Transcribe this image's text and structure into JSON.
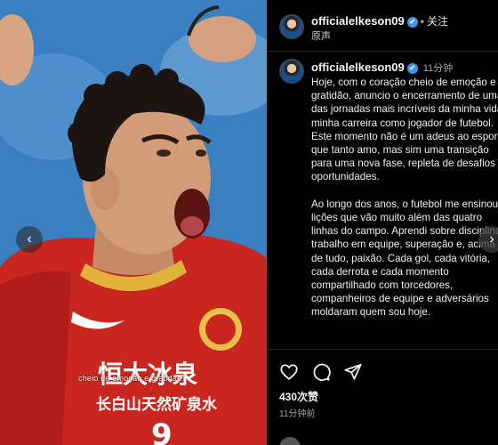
{
  "media": {
    "caption": "cheio de emoção e gratidão",
    "sponsor_line1": "恒大冰泉",
    "sponsor_line2": "长白山天然矿泉水",
    "jersey_number": "9",
    "prev_label": "‹",
    "next_label": "›"
  },
  "header": {
    "username": "officialelkeson09",
    "verified_mark": "✔",
    "separator": "•",
    "follow_label": "关注",
    "audio_label": "原声"
  },
  "post": {
    "username": "officialelkeson09",
    "verified_mark": "✔",
    "time": "11分钟",
    "text": "Hoje, com o coração cheio de emoção e gratidão, anuncio o encerramento de uma das jornadas mais incríveis da minha vida: minha carreira como jogador de futebol. Este momento não é um adeus ao esporte que tanto amo, mas sim uma transição para uma nova fase, repleta de desafios e oportunidades.\n\nAo longo dos anos, o futebol me ensinou lições que vão muito além das quatro linhas do campo. Aprendi sobre disciplina, trabalho em equipe, superação e, acima de tudo, paixão. Cada gol, cada vitória, cada derrota e cada momento compartilhado com torcedores, companheiros de equipe e adversários moldaram quem sou hoje."
  },
  "actions": {
    "like_icon": "heart-icon",
    "comment_icon": "comment-icon",
    "share_icon": "send-icon",
    "likes": "430次赞",
    "ago": "11分钟前"
  },
  "colors": {
    "background": "#000000",
    "verified": "#3897f0",
    "muted": "#a8a8a8",
    "jersey_red": "#c8261f"
  }
}
